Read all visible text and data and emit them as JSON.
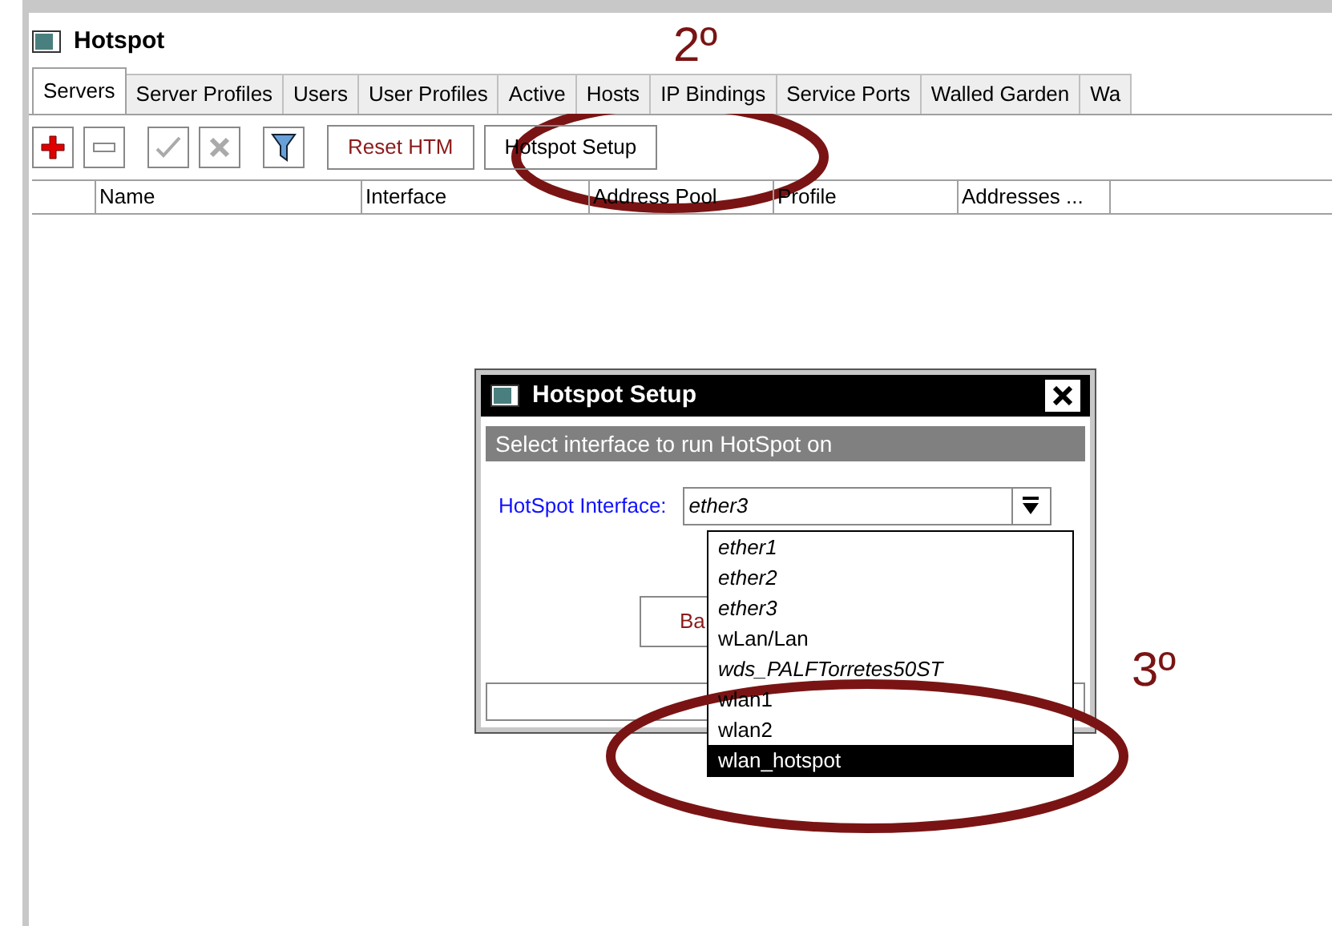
{
  "window": {
    "title": "Hotspot"
  },
  "tabs": [
    {
      "label": "Servers",
      "selected": true
    },
    {
      "label": "Server Profiles",
      "selected": false
    },
    {
      "label": "Users",
      "selected": false
    },
    {
      "label": "User Profiles",
      "selected": false
    },
    {
      "label": "Active",
      "selected": false
    },
    {
      "label": "Hosts",
      "selected": false
    },
    {
      "label": "IP Bindings",
      "selected": false
    },
    {
      "label": "Service Ports",
      "selected": false
    },
    {
      "label": "Walled Garden",
      "selected": false
    },
    {
      "label": "Wa",
      "selected": false
    }
  ],
  "toolbar": {
    "buttons": [
      "Reset HTM",
      "Hotspot Setup"
    ]
  },
  "table": {
    "columns": [
      "Name",
      "Interface",
      "Address Pool",
      "Profile",
      "Addresses ..."
    ]
  },
  "dialog": {
    "title": "Hotspot Setup",
    "banner": "Select interface to run HotSpot on",
    "field_label": "HotSpot Interface:",
    "field_value": "ether3",
    "button": "Ba",
    "options": [
      {
        "label": "ether1",
        "disabled": true,
        "selected": false
      },
      {
        "label": "ether2",
        "disabled": true,
        "selected": false
      },
      {
        "label": "ether3",
        "disabled": true,
        "selected": false
      },
      {
        "label": "wLan/Lan",
        "disabled": false,
        "selected": false
      },
      {
        "label": "wds_PALFTorretes50ST",
        "disabled": true,
        "selected": false
      },
      {
        "label": "wlan1",
        "disabled": false,
        "selected": false
      },
      {
        "label": "wlan2",
        "disabled": false,
        "selected": false
      },
      {
        "label": "wlan_hotspot",
        "disabled": false,
        "selected": true
      }
    ]
  },
  "annotations": [
    "2º",
    "3º"
  ]
}
